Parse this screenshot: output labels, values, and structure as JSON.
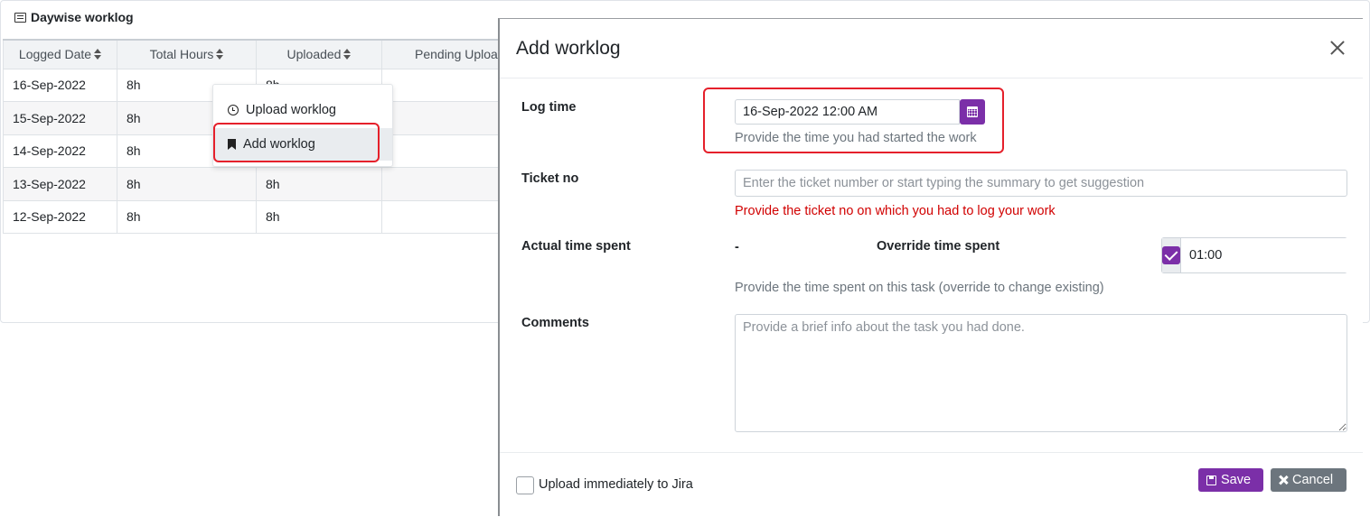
{
  "panel": {
    "title": "Daywise worklog",
    "columns": [
      "Logged Date",
      "Total Hours",
      "Uploaded",
      "Pending Uploa"
    ],
    "rows": [
      {
        "date": "16-Sep-2022",
        "total": "8h",
        "uploaded": "8h"
      },
      {
        "date": "15-Sep-2022",
        "total": "8h",
        "uploaded": ""
      },
      {
        "date": "14-Sep-2022",
        "total": "8h",
        "uploaded": ""
      },
      {
        "date": "13-Sep-2022",
        "total": "8h",
        "uploaded": "8h"
      },
      {
        "date": "12-Sep-2022",
        "total": "8h",
        "uploaded": "8h"
      }
    ]
  },
  "context_menu": {
    "upload_label": "Upload worklog",
    "add_label": "Add worklog"
  },
  "modal": {
    "title": "Add worklog",
    "log_time": {
      "label": "Log time",
      "value": "16-Sep-2022 12:00 AM",
      "help": "Provide the time you had started the work"
    },
    "ticket": {
      "label": "Ticket no",
      "placeholder": "Enter the ticket number or start typing the summary to get suggestion",
      "error": "Provide the ticket no on which you had to log your work"
    },
    "time_spent": {
      "label": "Actual time spent",
      "actual_value": "-",
      "override_label": "Override time spent",
      "override_value": "01:00",
      "help": "Provide the time spent on this task (override to change existing)"
    },
    "comments": {
      "label": "Comments",
      "placeholder": "Provide a brief info about the task you had done."
    },
    "footer": {
      "upload_label": "Upload immediately to Jira",
      "save_label": "Save",
      "cancel_label": "Cancel"
    }
  },
  "colors": {
    "accent": "#7b2fa8",
    "error": "#d10000",
    "highlight": "#e5202b",
    "secondary": "#6c757d"
  }
}
